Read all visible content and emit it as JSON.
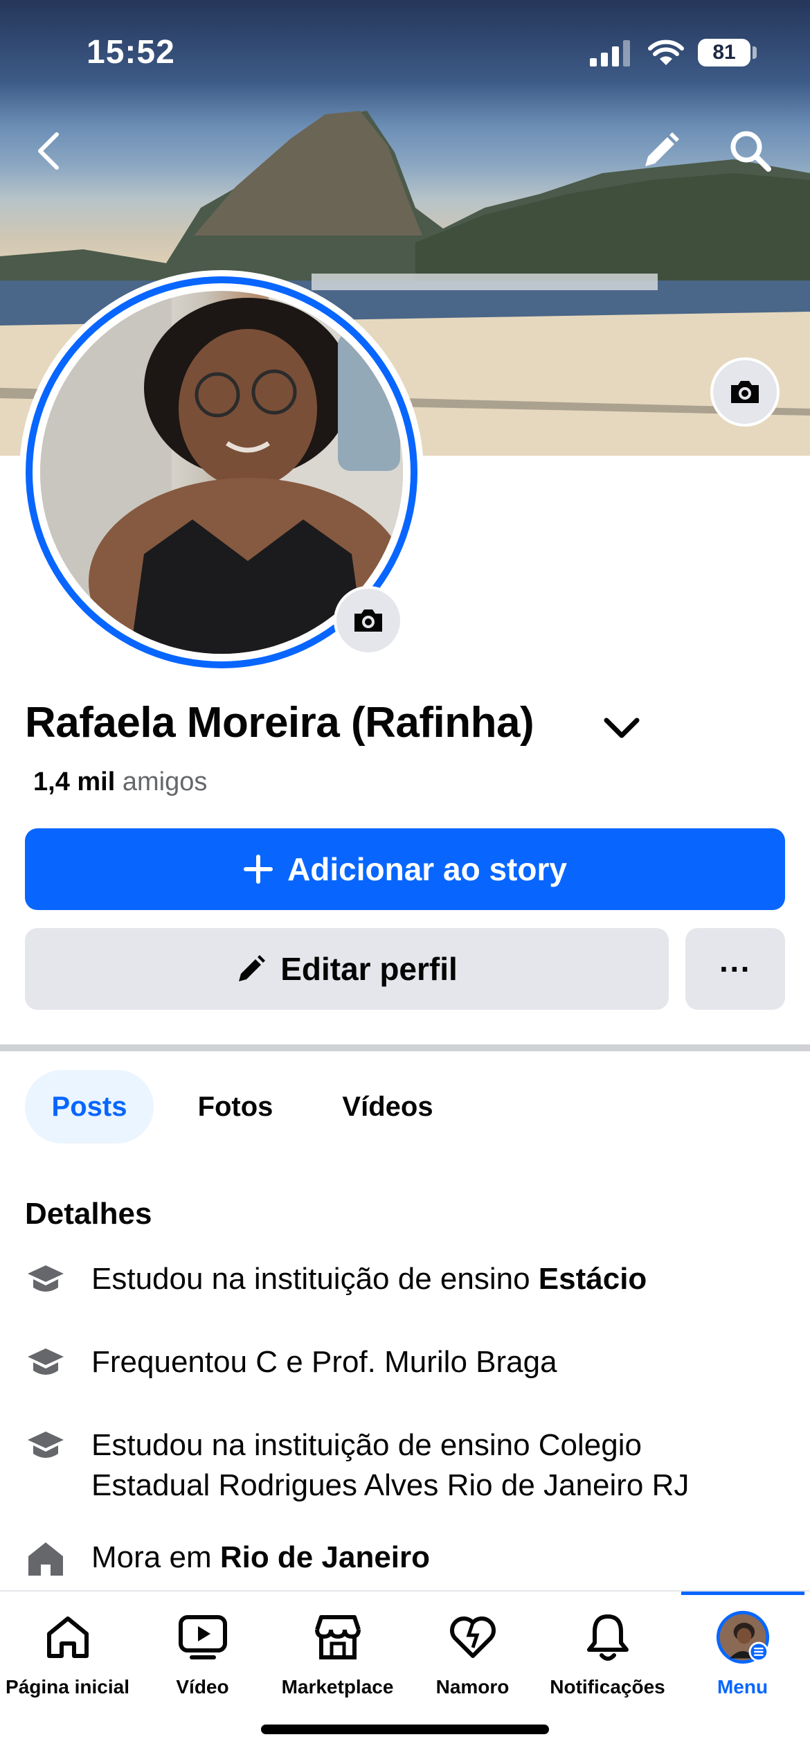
{
  "status_bar": {
    "time": "15:52",
    "battery": "81"
  },
  "profile": {
    "name": "Rafaela Moreira (Rafinha)",
    "friends_count": "1,4 mil",
    "friends_label": "amigos"
  },
  "actions": {
    "add_story": "Adicionar ao story",
    "edit_profile": "Editar perfil",
    "more": "···"
  },
  "tabs": [
    {
      "label": "Posts",
      "active": true
    },
    {
      "label": "Fotos",
      "active": false
    },
    {
      "label": "Vídeos",
      "active": false
    }
  ],
  "details": {
    "title": "Detalhes",
    "items": [
      {
        "icon": "graduation-cap-icon",
        "prefix": "Estudou na instituição de ensino ",
        "bold": "Estácio"
      },
      {
        "icon": "graduation-cap-icon",
        "prefix": "Frequentou C e Prof. Murilo Braga",
        "bold": ""
      },
      {
        "icon": "graduation-cap-icon",
        "prefix": "Estudou na instituição de ensino Colegio Estadual Rodrigues Alves Rio de Janeiro RJ",
        "bold": ""
      },
      {
        "icon": "home-icon",
        "prefix": "Mora em ",
        "bold": "Rio de Janeiro"
      }
    ]
  },
  "bottom_nav": [
    {
      "label": "Página inicial",
      "icon": "home-icon"
    },
    {
      "label": "Vídeo",
      "icon": "video-icon"
    },
    {
      "label": "Marketplace",
      "icon": "marketplace-icon"
    },
    {
      "label": "Namoro",
      "icon": "dating-heart-icon"
    },
    {
      "label": "Notificações",
      "icon": "bell-icon"
    },
    {
      "label": "Menu",
      "icon": "avatar-menu-icon",
      "active": true
    }
  ],
  "colors": {
    "accent": "#0866ff",
    "button_gray": "#e4e6eb",
    "active_tab_bg": "#ebf5ff"
  }
}
